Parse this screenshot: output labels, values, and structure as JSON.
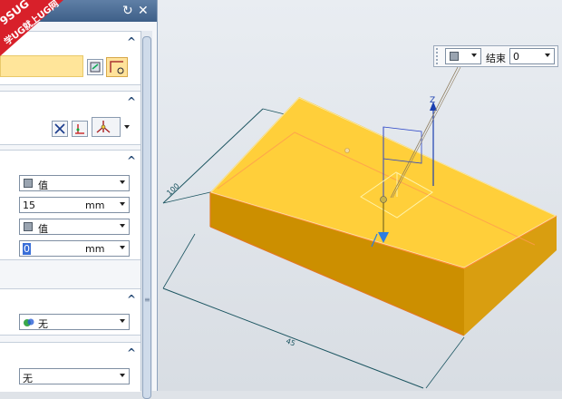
{
  "logo": {
    "line1": "9SUG",
    "line2": "学UG就上UG网"
  },
  "panel": {
    "type_dropdown_1": {
      "value": "值"
    },
    "start_distance": {
      "value": "15",
      "unit": "mm"
    },
    "type_dropdown_2": {
      "value": "值"
    },
    "end_distance": {
      "value": "0",
      "unit": "mm"
    },
    "boolean_dropdown": {
      "value": "无"
    },
    "draft_dropdown": {
      "value": "无"
    }
  },
  "float_toolbar": {
    "end_label": "结束",
    "end_value": "0"
  },
  "model": {
    "dim_length": "100",
    "dim_width": "45",
    "axis_label": "Z"
  },
  "colors": {
    "block_top": "#ffcf3a",
    "block_front": "#cc8f00",
    "block_side": "#d99e10",
    "highlight": "#fff3a8",
    "titlebar": "#4a6b94"
  }
}
